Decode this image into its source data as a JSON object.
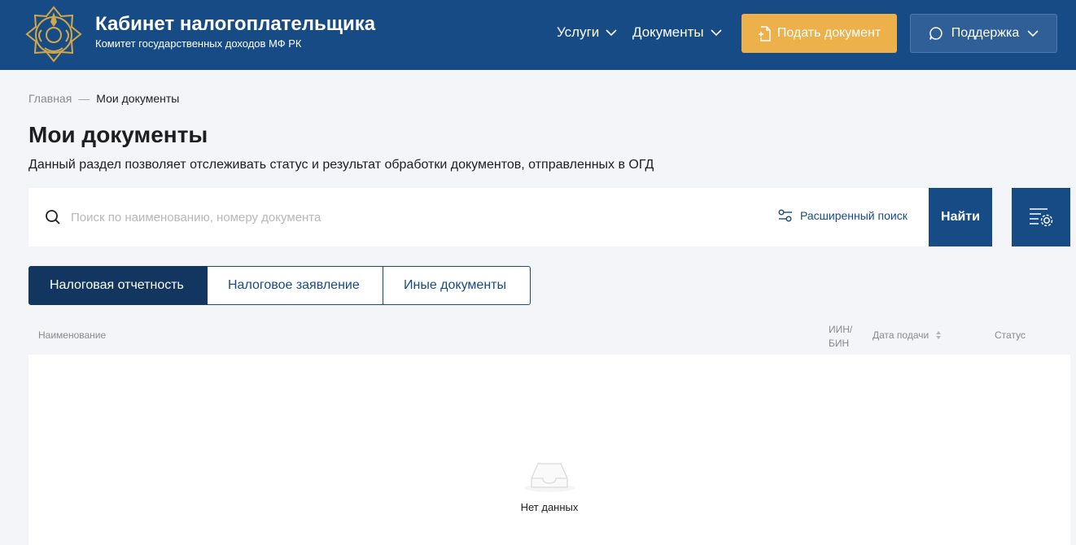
{
  "header": {
    "title": "Кабинет налогоплательщика",
    "subtitle": "Комитет государственных доходов МФ РК",
    "nav": [
      {
        "label": "Услуги"
      },
      {
        "label": "Документы"
      }
    ],
    "submit_button": "Подать документ",
    "support_button": "Поддержка",
    "colors": {
      "header_bg": "#174b86",
      "submit_bg": "#ecb14b",
      "support_bg": "#2f5f96"
    }
  },
  "breadcrumb": {
    "home": "Главная",
    "separator": "—",
    "current": "Мои документы"
  },
  "page": {
    "title": "Мои документы",
    "description": "Данный раздел позволяет отслеживать статус и результат обработки документов, отправленных в ОГД"
  },
  "search": {
    "placeholder": "Поиск по наименованию, номеру документа",
    "value": "",
    "advanced_label": "Расширенный поиск",
    "find_button": "Найти"
  },
  "tabs": [
    {
      "label": "Налоговая отчетность",
      "active": true
    },
    {
      "label": "Налоговое заявление",
      "active": false
    },
    {
      "label": "Иные документы",
      "active": false
    }
  ],
  "table": {
    "columns": {
      "name": "Наименование",
      "iin_line1": "ИИН/",
      "iin_line2": "БИН",
      "date": "Дата подачи",
      "status": "Статус"
    },
    "rows": [],
    "empty_text": "Нет данных"
  },
  "icons": {
    "logo": "emblem-logo",
    "search": "search-icon",
    "advanced": "filter-sliders-icon",
    "settings": "list-settings-icon",
    "empty": "empty-inbox-icon"
  }
}
